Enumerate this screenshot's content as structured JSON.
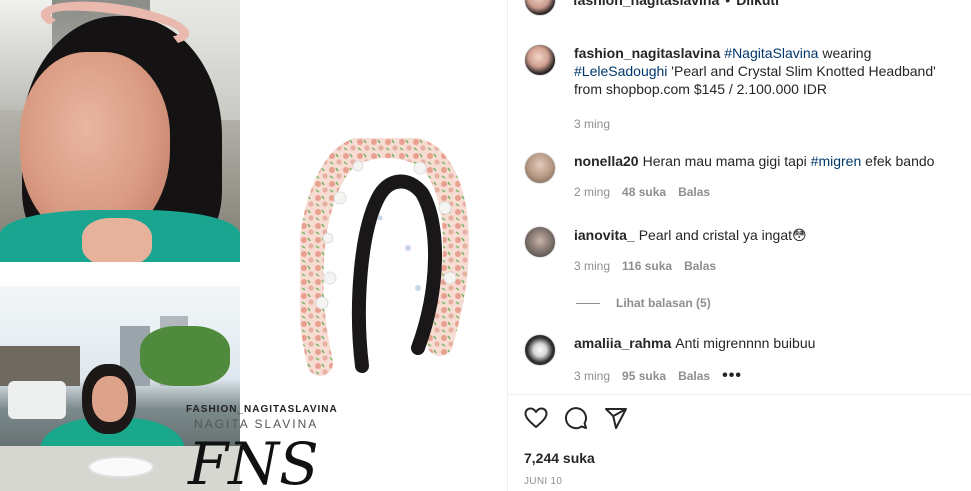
{
  "post": {
    "header_username": "fashion_nagitaslavina",
    "header_separator": "•",
    "header_follow": "Diikuti"
  },
  "media": {
    "watermark_line1": "FASHION_NAGITASLAVINA",
    "watermark_line2": "NAGITA SLAVINA",
    "watermark_logo": "FNS"
  },
  "caption": {
    "username": "fashion_nagitaslavina",
    "tag1": "#NagitaSlavina",
    "text1": " wearing ",
    "tag2": "#LeleSadoughi",
    "text2": " 'Pearl and Crystal Slim Knotted Headband' from shopbop.com $145 / 2.100.000 IDR",
    "time": "3 ming"
  },
  "comments": [
    {
      "username": "nonella20",
      "text_before": "Heran mau mama gigi tapi ",
      "tag": "#migren",
      "text_after": " efek bando",
      "time": "2 ming",
      "likes": "48 suka",
      "reply": "Balas",
      "avatar_color": "#b89a84"
    },
    {
      "username": "ianovita_",
      "text_before": "Pearl and cristal ya ingat😳",
      "tag": "",
      "text_after": "",
      "time": "3 ming",
      "likes": "116 suka",
      "reply": "Balas",
      "avatar_color": "#7a6f6a"
    },
    {
      "username": "amaliia_rahma",
      "text_before": "Anti migrennnn buibuu",
      "tag": "",
      "text_after": "",
      "time": "3 ming",
      "likes": "95 suka",
      "reply": "Balas",
      "more": "•••",
      "avatar_color": "#3a3a3a"
    }
  ],
  "view_replies": "Lihat balasan (5)",
  "actions": {
    "like": "heart-icon",
    "comment": "comment-icon",
    "share": "share-icon"
  },
  "likes_count": "7,244 suka",
  "date": "JUNI 10"
}
